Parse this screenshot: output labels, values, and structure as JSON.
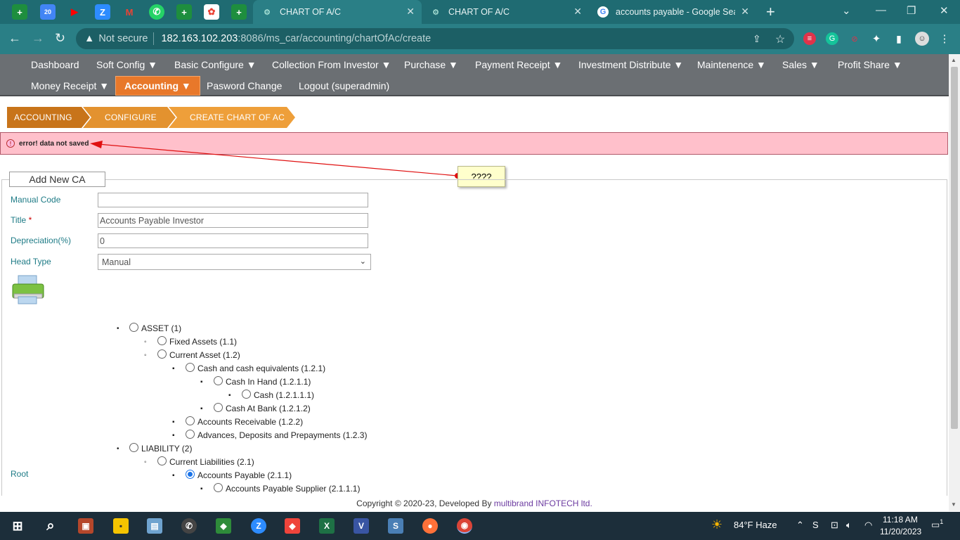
{
  "browser": {
    "tabs": [
      {
        "title": "CHART OF A/C",
        "active": true
      },
      {
        "title": "CHART OF A/C",
        "active": false
      },
      {
        "title": "accounts payable - Google Search",
        "active": false
      }
    ],
    "pinned_badge": "20",
    "new_tab_label": "+",
    "address": {
      "security": "Not secure",
      "host": "182.163.102.203",
      "path": ":8086/ms_car/accounting/chartOfAc/create"
    }
  },
  "menu": {
    "row1": [
      "Dashboard",
      "Soft Config ▼",
      "Basic Configure ▼",
      "Collection From Investor ▼",
      "Purchase ▼",
      "Payment Receipt ▼",
      "Investment Distribute ▼",
      "Maintenence ▼",
      "Sales ▼",
      "Profit Share ▼"
    ],
    "row2": [
      "Money Receipt ▼",
      "Accounting ▼",
      "Pasword Change",
      "Logout (superadmin)"
    ],
    "active_item": "Accounting ▼"
  },
  "breadcrumb": [
    "ACCOUNTING",
    "CONFIGURE",
    "CREATE CHART OF AC"
  ],
  "error": {
    "message": "error! data not saved"
  },
  "annotation": {
    "text": "????"
  },
  "form": {
    "legend": "Add New CA",
    "manual_code": {
      "label": "Manual Code",
      "value": ""
    },
    "title": {
      "label": "Title",
      "required_mark": "*",
      "value": "Accounts Payable Investor"
    },
    "depreciation": {
      "label": "Depreciation(%)",
      "value": "0"
    },
    "head_type": {
      "label": "Head Type",
      "value": "Manual"
    },
    "root_label": "Root"
  },
  "tree": [
    {
      "label": "ASSET (1)",
      "level": 0,
      "selected": false
    },
    {
      "label": "Fixed Assets (1.1)",
      "level": 1,
      "selected": false
    },
    {
      "label": "Current Asset (1.2)",
      "level": 1,
      "selected": false
    },
    {
      "label": "Cash and cash equivalents (1.2.1)",
      "level": 2,
      "selected": false
    },
    {
      "label": "Cash In Hand (1.2.1.1)",
      "level": 3,
      "selected": false
    },
    {
      "label": "Cash (1.2.1.1.1)",
      "level": 4,
      "selected": false
    },
    {
      "label": "Cash At Bank (1.2.1.2)",
      "level": 3,
      "selected": false
    },
    {
      "label": "Accounts Receivable (1.2.2)",
      "level": 2,
      "selected": false
    },
    {
      "label": "Advances, Deposits and Prepayments (1.2.3)",
      "level": 2,
      "selected": false
    },
    {
      "label": "LIABILITY (2)",
      "level": 0,
      "selected": false
    },
    {
      "label": "Current Liabilities (2.1)",
      "level": 1,
      "selected": false
    },
    {
      "label": "Accounts Payable (2.1.1)",
      "level": 2,
      "selected": true
    },
    {
      "label": "Accounts Payable Supplier (2.1.1.1)",
      "level": 3,
      "selected": false
    }
  ],
  "footer": {
    "prefix": "Copyright © 2020-23, Developed By ",
    "company": "multibrand INFOTECH ltd."
  },
  "taskbar": {
    "weather": "84°F  Haze",
    "time": "11:18 AM",
    "date": "11/20/2023",
    "notification_count": "1"
  },
  "colors": {
    "menu_active": "#e8782a",
    "crumb_dark": "#c8741a",
    "crumb_light": "#ee9f3a",
    "error_bg": "#ffc0cb",
    "label_teal": "#1e7b86"
  }
}
